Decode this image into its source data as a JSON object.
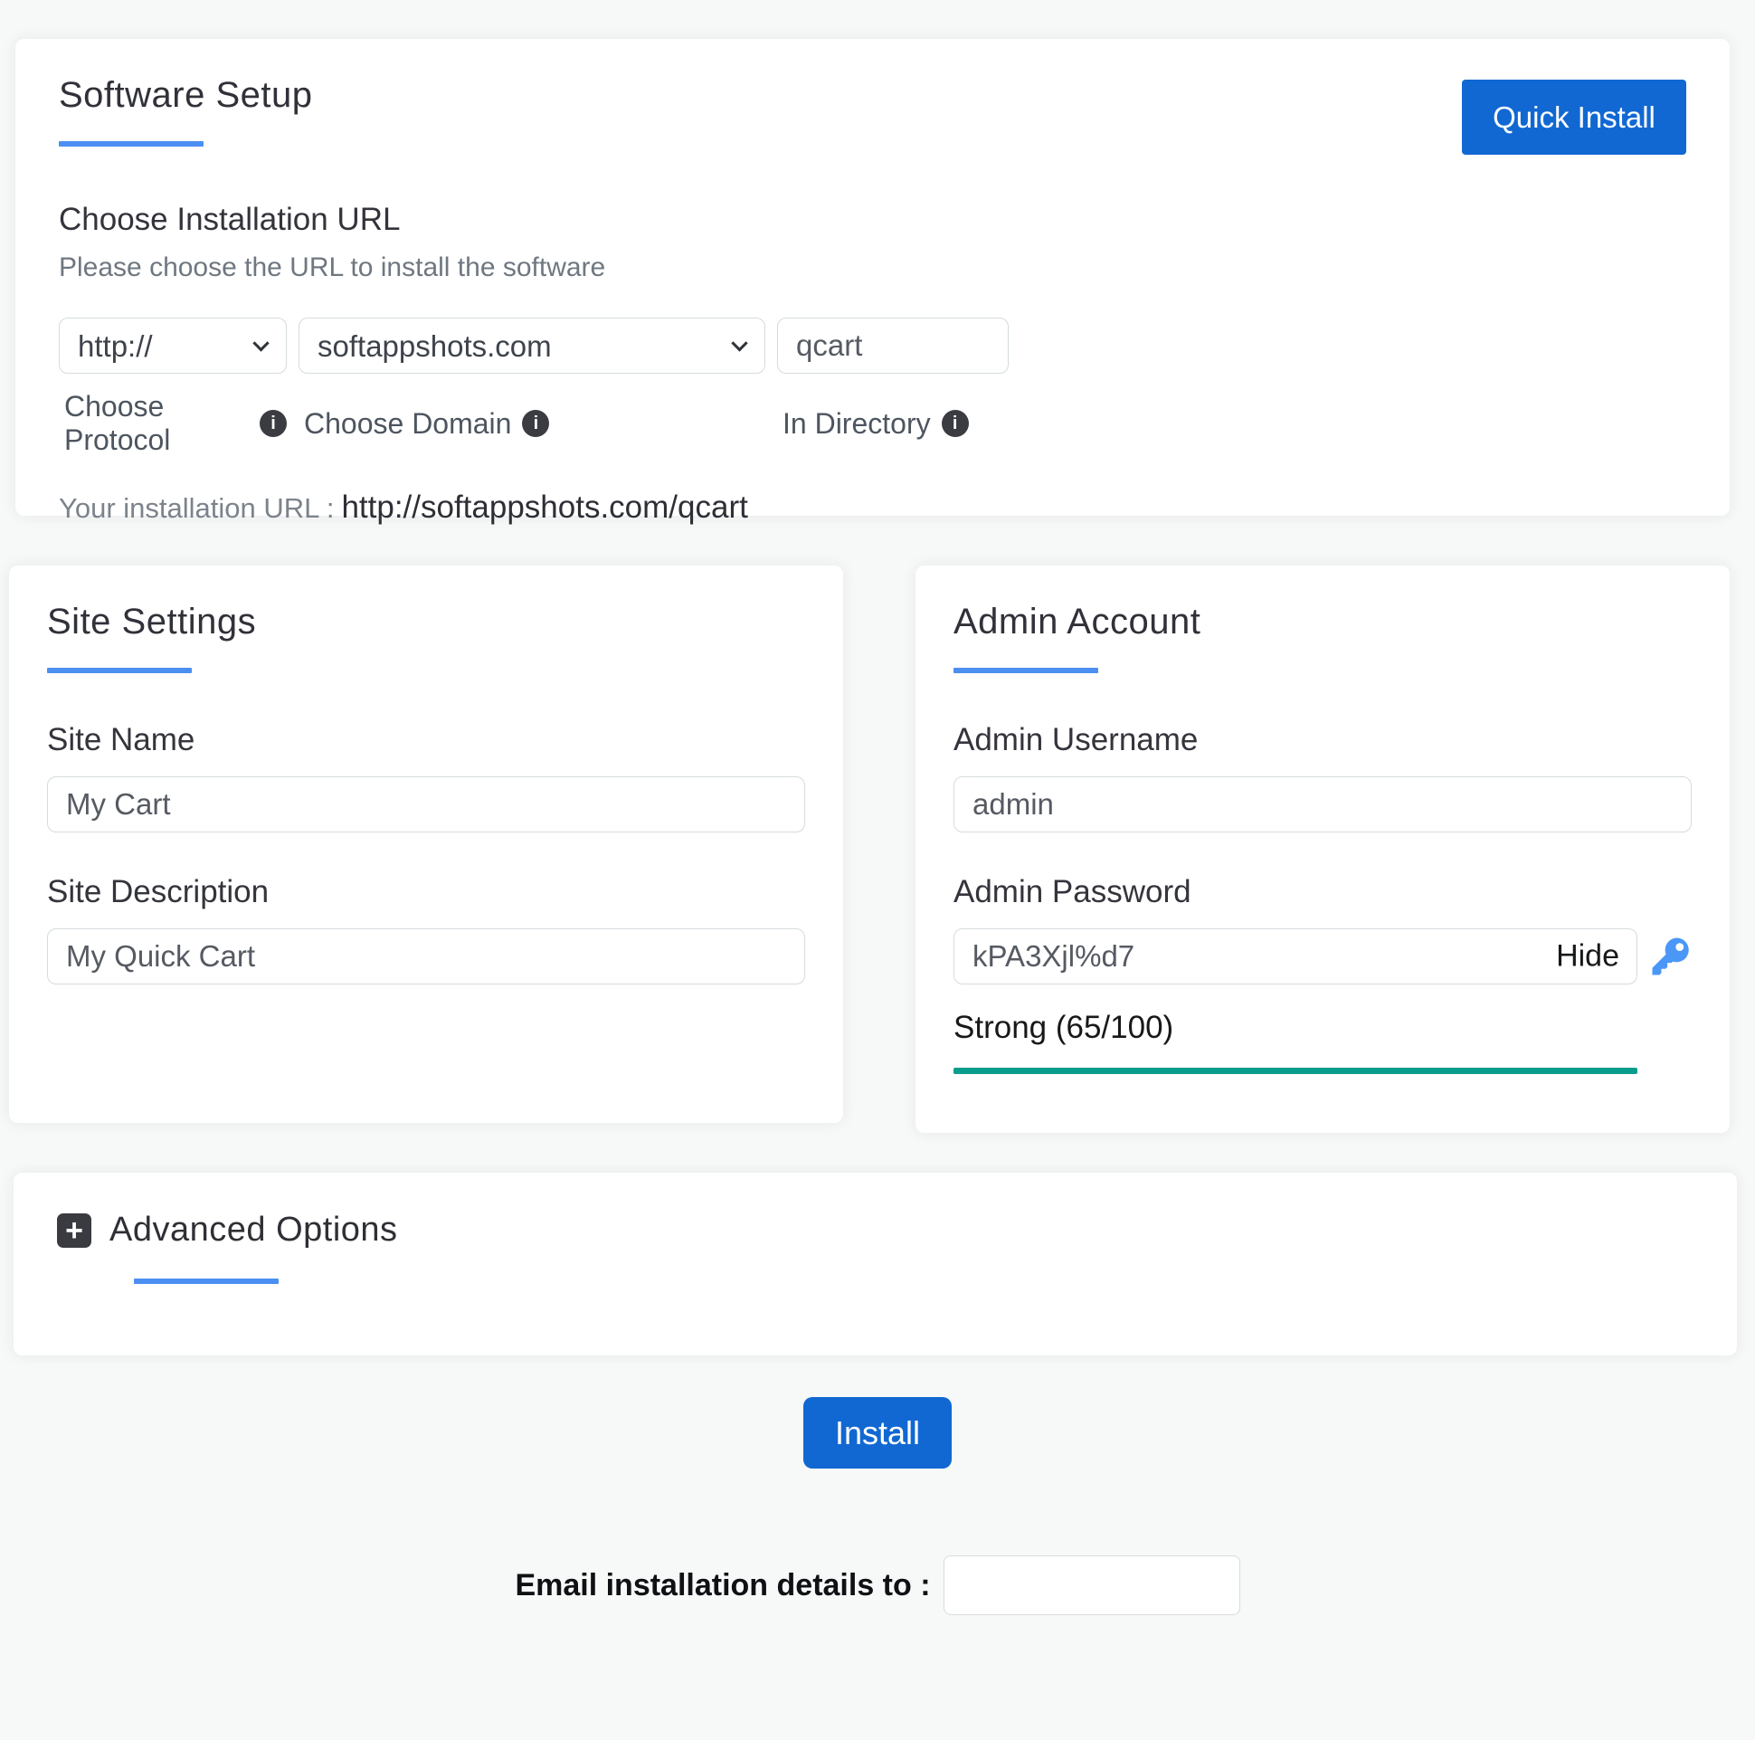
{
  "colors": {
    "accent_underline": "#4b8ff2",
    "button_blue": "#1168d2",
    "strength_teal": "#0b9d8c",
    "key_icon_blue": "#4b97f7",
    "info_icon_bg": "#3b3c41"
  },
  "software_setup": {
    "title": "Software Setup",
    "quick_install_label": "Quick Install",
    "section_title": "Choose Installation URL",
    "section_subtitle": "Please choose the URL to install the software",
    "protocol": {
      "value": "http://",
      "label": "Choose Protocol"
    },
    "domain": {
      "value": "softappshots.com",
      "label": "Choose Domain"
    },
    "directory": {
      "value": "qcart",
      "label": "In Directory"
    },
    "installation_url_label": "Your installation URL :",
    "installation_url_value": "http://softappshots.com/qcart"
  },
  "site_settings": {
    "title": "Site Settings",
    "site_name_label": "Site Name",
    "site_name_value": "My Cart",
    "site_description_label": "Site Description",
    "site_description_value": "My Quick Cart"
  },
  "admin_account": {
    "title": "Admin Account",
    "username_label": "Admin Username",
    "username_value": "admin",
    "password_label": "Admin Password",
    "password_value": "kPA3Xjl%d7",
    "hide_label": "Hide",
    "strength_text": "Strong (65/100)",
    "strength_percent": "100"
  },
  "advanced_options": {
    "title": "Advanced Options",
    "plus_glyph": "+"
  },
  "footer": {
    "install_label": "Install",
    "email_label": "Email installation details to :",
    "email_value": ""
  }
}
